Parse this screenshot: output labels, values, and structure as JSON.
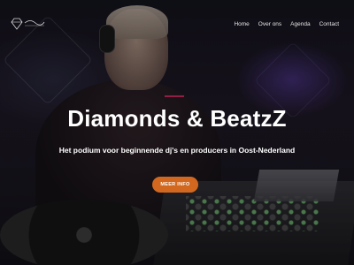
{
  "header": {
    "logo_icon": "diamond-logo-icon",
    "nav": [
      {
        "label": "Home"
      },
      {
        "label": "Over ons"
      },
      {
        "label": "Agenda"
      },
      {
        "label": "Contact"
      }
    ]
  },
  "hero": {
    "title": "Diamonds & BeatzZ",
    "subtitle": "Het podium voor beginnende dj's en producers in Oost-Nederland",
    "cta_label": "MEER INFO",
    "background_image": "dj-at-turntables-photo"
  },
  "colors": {
    "accent": "#d2681f",
    "text": "#ffffff",
    "highlight_line": "#c0265a"
  }
}
